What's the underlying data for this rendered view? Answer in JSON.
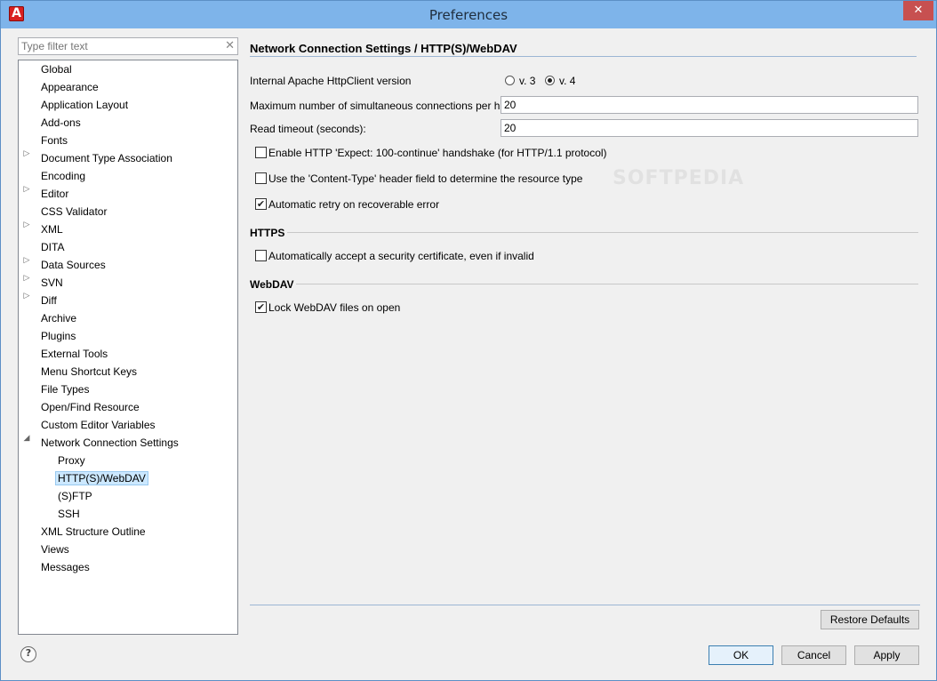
{
  "window": {
    "title": "Preferences",
    "close_glyph": "✕",
    "app_icon_letter": "A"
  },
  "filter": {
    "placeholder": "Type filter text",
    "clear_glyph": "✕"
  },
  "tree": {
    "items": [
      {
        "label": "Global"
      },
      {
        "label": "Appearance"
      },
      {
        "label": "Application Layout"
      },
      {
        "label": "Add-ons"
      },
      {
        "label": "Fonts"
      },
      {
        "label": "Document Type Association",
        "expandable": true
      },
      {
        "label": "Encoding"
      },
      {
        "label": "Editor",
        "expandable": true
      },
      {
        "label": "CSS Validator"
      },
      {
        "label": "XML",
        "expandable": true
      },
      {
        "label": "DITA"
      },
      {
        "label": "Data Sources",
        "expandable": true
      },
      {
        "label": "SVN",
        "expandable": true
      },
      {
        "label": "Diff",
        "expandable": true
      },
      {
        "label": "Archive"
      },
      {
        "label": "Plugins"
      },
      {
        "label": "External Tools"
      },
      {
        "label": "Menu Shortcut Keys"
      },
      {
        "label": "File Types"
      },
      {
        "label": "Open/Find Resource"
      },
      {
        "label": "Custom Editor Variables"
      },
      {
        "label": "Network Connection Settings",
        "expanded": true
      },
      {
        "label": "Proxy",
        "child": true
      },
      {
        "label": "HTTP(S)/WebDAV",
        "child": true,
        "selected": true
      },
      {
        "label": "(S)FTP",
        "child": true
      },
      {
        "label": "SSH",
        "child": true
      },
      {
        "label": "XML Structure Outline"
      },
      {
        "label": "Views"
      },
      {
        "label": "Messages"
      }
    ],
    "collapsed_glyph": "▷",
    "expanded_glyph": "◢"
  },
  "page": {
    "title": "Network Connection Settings / HTTP(S)/WebDAV",
    "httpclient_label": "Internal Apache HttpClient version",
    "radio_v3": "v. 3",
    "radio_v4": "v. 4",
    "radio_selected": "v. 4",
    "max_conn_label": "Maximum number of simultaneous connections per host:",
    "max_conn_value": "20",
    "read_timeout_label": "Read timeout (seconds):",
    "read_timeout_value": "20",
    "expect_continue_label": "Enable HTTP 'Expect: 100-continue' handshake (for HTTP/1.1 protocol)",
    "expect_continue_checked": false,
    "content_type_label": "Use the 'Content-Type' header field to determine the resource type",
    "content_type_checked": false,
    "auto_retry_label": "Automatic retry on recoverable error",
    "auto_retry_checked": true,
    "https_section": "HTTPS",
    "accept_cert_label": "Automatically accept a security certificate, even if invalid",
    "accept_cert_checked": false,
    "webdav_section": "WebDAV",
    "lock_webdav_label": "Lock WebDAV files on open",
    "lock_webdav_checked": true,
    "check_glyph": "✔",
    "watermark": "SOFTPEDIA"
  },
  "buttons": {
    "restore_defaults": "Restore Defaults",
    "ok": "OK",
    "cancel": "Cancel",
    "apply": "Apply",
    "help_glyph": "?"
  }
}
